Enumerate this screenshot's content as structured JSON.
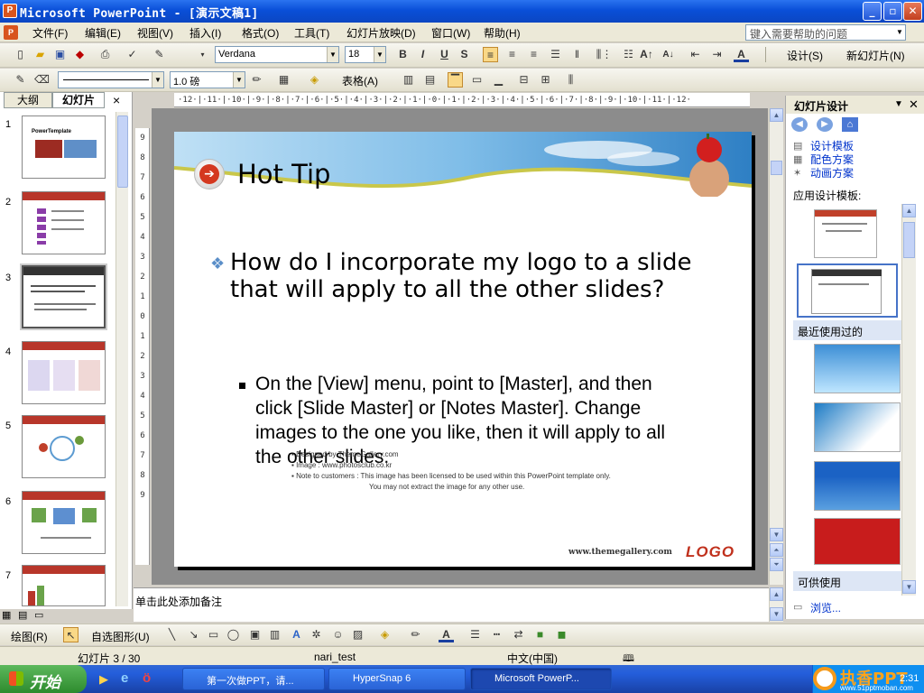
{
  "window": {
    "title": "Microsoft PowerPoint - [演示文稿1]",
    "min": "_",
    "max": "▫",
    "close": "✕"
  },
  "menu": {
    "items": [
      "文件(F)",
      "编辑(E)",
      "视图(V)",
      "插入(I)",
      "格式(O)",
      "工具(T)",
      "幻灯片放映(D)",
      "窗口(W)",
      "帮助(H)"
    ],
    "help_placeholder": "键入需要帮助的问题"
  },
  "toolbar1": {
    "font": "Verdana",
    "size": "18",
    "bold": "B",
    "italic": "I",
    "underline": "U",
    "shadow": "S",
    "design": "设计(S)",
    "new_slide": "新幻灯片(N)"
  },
  "toolbar2": {
    "line_weight": "1.0 磅",
    "table": "表格(A)"
  },
  "leftpane": {
    "tab_outline": "大纲",
    "tab_slides": "幻灯片",
    "close": "×",
    "slide_numbers": [
      "1",
      "2",
      "3",
      "4",
      "5",
      "6",
      "7"
    ]
  },
  "ruler": {
    "h": "·12·|·11·|·10·|·9·|·8·|·7·|·6·|·5·|·4·|·3·|·2·|·1·|·0·|·1·|·2·|·3·|·4·|·5·|·6·|·7·|·8·|·9·|·10·|·11·|·12·"
  },
  "slide": {
    "title": "Hot Tip",
    "question": "How do I incorporate my logo to a slide that will apply to all the other slides?",
    "answer": "On the [View] menu, point to [Master], and then click [Slide Master] or [Notes Master]. Change images to the one you like, then it will apply to all the other slides.",
    "credits": [
      "Designed by ThemeGallery.com",
      "Image : www.photosclub.co.kr",
      "Note to customers : This image has been licensed to be used within this PowerPoint template only.",
      "You may not extract the image for any other use."
    ],
    "footer_url": "www.themegallery.com",
    "logo": "LOGO"
  },
  "notes": {
    "placeholder": "单击此处添加备注"
  },
  "taskpane": {
    "title": "幻灯片设计",
    "links": [
      "设计模板",
      "配色方案",
      "动画方案"
    ],
    "apply_label": "应用设计模板:",
    "recent_label": "最近使用过的",
    "available_label": "可供使用",
    "browse": "浏览..."
  },
  "drawbar": {
    "draw": "绘图(R)",
    "autoshapes": "自选图形(U)"
  },
  "status": {
    "slide": "幻灯片 3 / 30",
    "template": "nari_test",
    "language": "中文(中国)"
  },
  "taskbar": {
    "start": "开始",
    "tasks": [
      "第一次做PPT，请...",
      "HyperSnap 6",
      "Microsoft PowerP..."
    ],
    "brand": "执香PPT",
    "brand_url": "www.51pptmoban.com",
    "clock": "2:31"
  }
}
